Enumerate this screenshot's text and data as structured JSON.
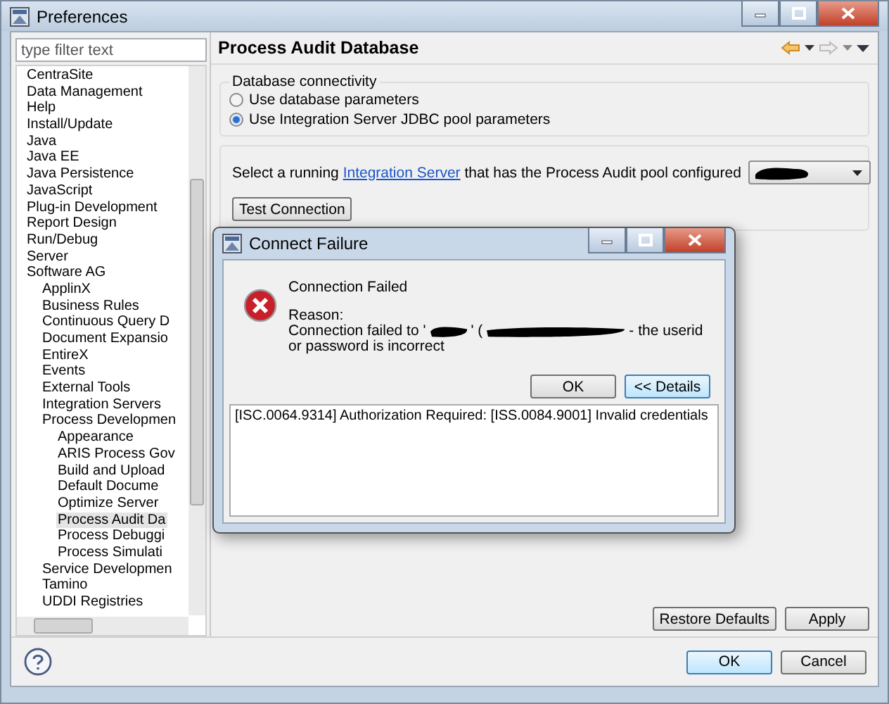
{
  "window": {
    "title": "Preferences"
  },
  "filter": {
    "placeholder": "type filter text"
  },
  "tree": {
    "items": [
      {
        "label": "CentraSite",
        "selected": false
      },
      {
        "label": "Data Management",
        "selected": false
      },
      {
        "label": "Help",
        "selected": false
      },
      {
        "label": "Install/Update",
        "selected": false
      },
      {
        "label": "Java",
        "selected": false
      },
      {
        "label": "Java EE",
        "selected": false
      },
      {
        "label": "Java Persistence",
        "selected": false
      },
      {
        "label": "JavaScript",
        "selected": false
      },
      {
        "label": "Plug-in Development",
        "selected": false
      },
      {
        "label": "Report Design",
        "selected": false
      },
      {
        "label": "Run/Debug",
        "selected": false
      },
      {
        "label": "Server",
        "selected": false
      },
      {
        "label": "Software AG",
        "selected": false,
        "children": [
          {
            "label": "ApplinX",
            "selected": false
          },
          {
            "label": "Business Rules",
            "selected": false
          },
          {
            "label": "Continuous Query D",
            "selected": false
          },
          {
            "label": "Document Expansio",
            "selected": false
          },
          {
            "label": "EntireX",
            "selected": false
          },
          {
            "label": "Events",
            "selected": false
          },
          {
            "label": "External Tools",
            "selected": false
          },
          {
            "label": "Integration Servers",
            "selected": false
          },
          {
            "label": "Process Developmen",
            "selected": false,
            "children": [
              {
                "label": "Appearance",
                "selected": false
              },
              {
                "label": "ARIS Process Gov",
                "selected": false
              },
              {
                "label": "Build and Upload",
                "selected": false
              },
              {
                "label": "Default Docume",
                "selected": false
              },
              {
                "label": "Optimize Server",
                "selected": false
              },
              {
                "label": "Process Audit Da",
                "selected": true
              },
              {
                "label": "Process Debuggi",
                "selected": false
              },
              {
                "label": "Process Simulati",
                "selected": false
              }
            ]
          },
          {
            "label": "Service Developmen",
            "selected": false
          },
          {
            "label": "Tamino",
            "selected": false
          },
          {
            "label": "UDDI Registries",
            "selected": false
          }
        ]
      }
    ]
  },
  "page": {
    "title": "Process Audit Database",
    "connectivity": {
      "legend": "Database connectivity",
      "options": [
        {
          "label": "Use database parameters",
          "selected": false
        },
        {
          "label": "Use Integration Server JDBC pool parameters",
          "selected": true
        }
      ]
    },
    "server_select": {
      "before": "Select a running",
      "link": "Integration Server",
      "after": "that has the Process Audit pool configured"
    },
    "test_button": "Test Connection",
    "restore_button": "Restore Defaults",
    "apply_button": "Apply"
  },
  "footer": {
    "ok": "OK",
    "cancel": "Cancel"
  },
  "dialog": {
    "title": "Connect Failure",
    "heading": "Connection Failed",
    "reason_label": "Reason:",
    "message_lines": [
      [
        {
          "kind": "text",
          "text": "Connection failed to '"
        },
        {
          "kind": "redacted"
        },
        {
          "kind": "text",
          "text": "' ("
        },
        {
          "kind": "redacted"
        },
        {
          "kind": "text",
          "text": "- the userid"
        }
      ],
      [
        {
          "kind": "text",
          "text": "or password is incorrect"
        }
      ]
    ],
    "buttons": [
      {
        "label": "OK",
        "default": false
      },
      {
        "label": "<< Details",
        "default": true
      }
    ],
    "details": "[ISC.0064.9314] Authorization Required: [ISS.0084.9001] Invalid credentials"
  }
}
